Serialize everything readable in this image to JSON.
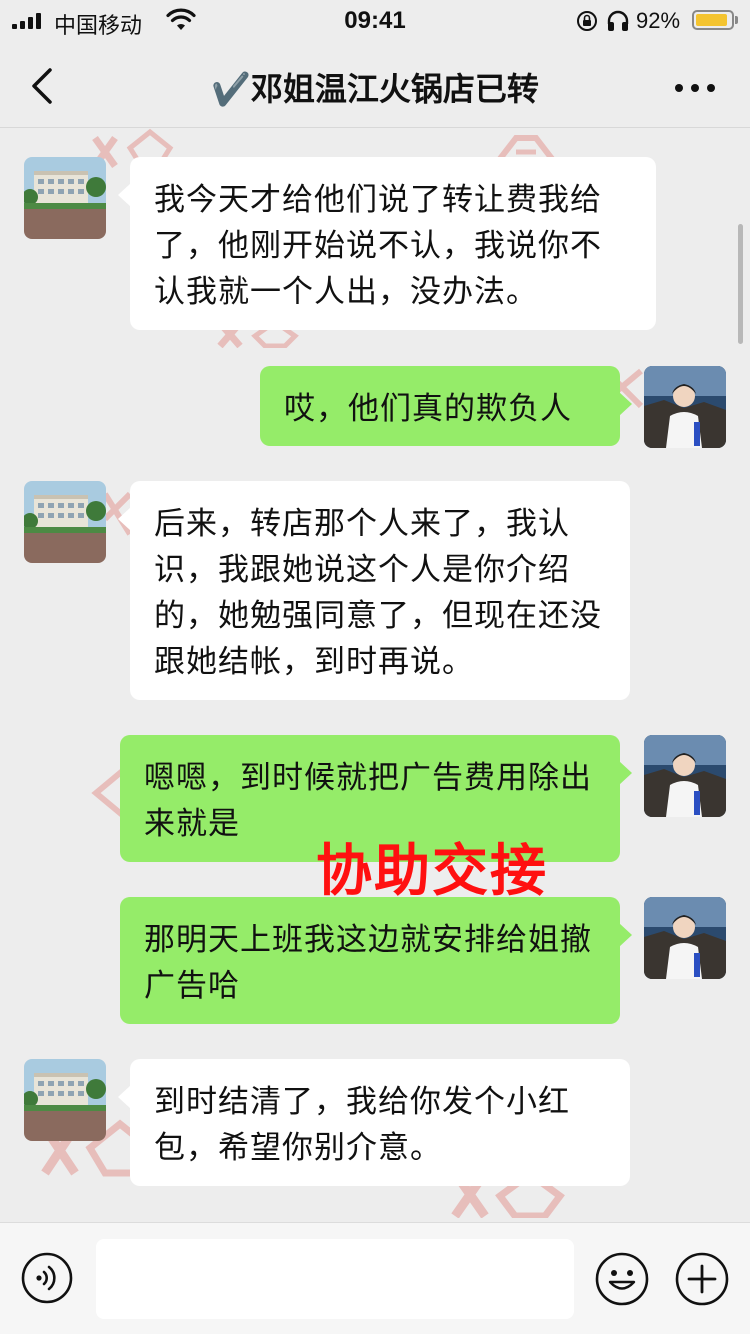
{
  "status_bar": {
    "carrier": "中国移动",
    "time": "09:41",
    "battery_percent": "92%",
    "battery_level": 0.92,
    "icons": [
      "signal-icon",
      "wifi-icon",
      "orientation-lock-icon",
      "headphones-icon",
      "battery-icon"
    ]
  },
  "nav": {
    "back_icon": "chevron-left-icon",
    "title": "✔️邓姐温江火锅店已转",
    "more_icon": "more-dots-icon"
  },
  "messages": [
    {
      "side": "incoming",
      "sender": "contact",
      "text": "我今天才给他们说了转让费我给了，他刚开始说不认，我说你不认我就一个人出，没办法。"
    },
    {
      "side": "outgoing",
      "sender": "me",
      "text": "哎，他们真的欺负人"
    },
    {
      "side": "incoming",
      "sender": "contact",
      "text": "后来，转店那个人来了，我认识，我跟她说这个人是你介绍的，她勉强同意了，但现在还没跟她结帐，到时再说。"
    },
    {
      "side": "outgoing",
      "sender": "me",
      "text": "嗯嗯，到时候就把广告费用除出来就是"
    },
    {
      "side": "outgoing",
      "sender": "me",
      "text": "那明天上班我这边就安排给姐撤广告哈"
    },
    {
      "side": "incoming",
      "sender": "contact",
      "text": "到时结清了，我给你发个小红包，希望你别介意。"
    }
  ],
  "overlay": {
    "label": "协助交接",
    "color": "#ff1010"
  },
  "input_bar": {
    "voice_icon": "voice-icon",
    "input_value": "",
    "emoji_icon": "emoji-icon",
    "plus_icon": "plus-icon"
  },
  "colors": {
    "background": "#ededed",
    "incoming_bubble": "#ffffff",
    "outgoing_bubble": "#95ec69",
    "watermark": "#d9342b"
  }
}
